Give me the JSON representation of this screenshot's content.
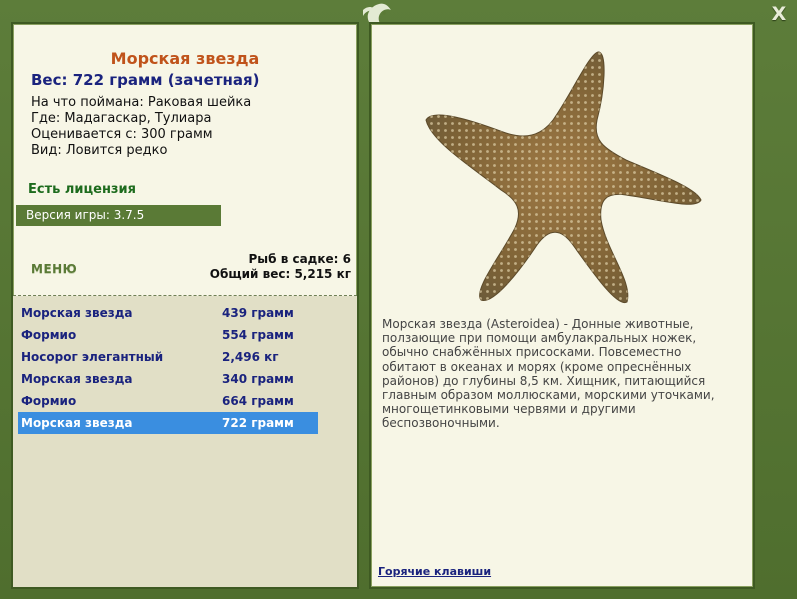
{
  "fish": {
    "name": "Морская звезда",
    "weight_line": "Вес: 722 грамм (зачетная)",
    "caught_on": "На что поймана: Раковая шейка",
    "location": "Где: Мадагаскар, Тулиара",
    "min_weight": "Оценивается с: 300 грамм",
    "rarity": "Вид: Ловится редко"
  },
  "license": "Есть лицензия",
  "version": "Версия игры: 3.7.5",
  "menu_label": "МЕНЮ",
  "stats": {
    "fish_count": "Рыб в садке: 6",
    "total_weight": "Общий вес: 5,215 кг"
  },
  "catches": [
    {
      "name": "Морская звезда",
      "weight": "439 грамм"
    },
    {
      "name": "Формио",
      "weight": "554 грамм"
    },
    {
      "name": "Носорог элегантный",
      "weight": "2,496 кг"
    },
    {
      "name": "Морская звезда",
      "weight": "340 грамм"
    },
    {
      "name": "Формио",
      "weight": "664 грамм"
    },
    {
      "name": "Морская звезда",
      "weight": "722 грамм"
    }
  ],
  "description": "Морская звезда (Asteroidea) - Донные животные, ползающие при помощи амбулакральных ножек, обычно снабжённых присосками. Повсеместно обитают в океанах и морях (кроме опреснённых районов) до глубины 8,5 км. Хищник, питающийся главным образом моллюсками, морскими уточками, многощетинковыми червями и другими беспозвоночными.",
  "hotkeys_label": "Горячие клавиши",
  "close_label": "X",
  "colors": {
    "frame": "#5a7a36",
    "panel": "#f7f6e6",
    "title": "#c0531b",
    "selected": "#3a8ee0",
    "link": "#1a237e"
  }
}
